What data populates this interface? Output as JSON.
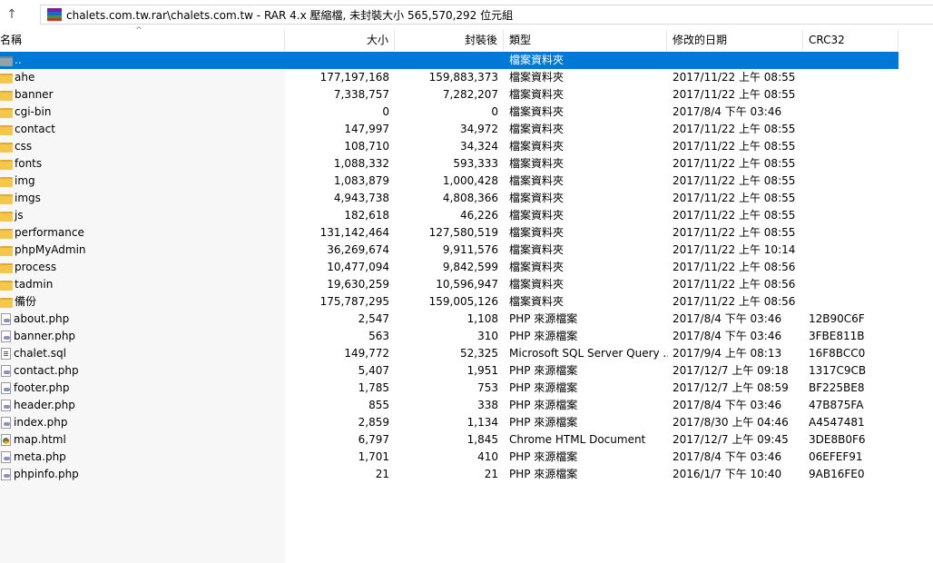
{
  "address_bar": {
    "text": "chalets.com.tw.rar\\chalets.com.tw - RAR 4.x 壓縮檔, 未封裝大小 565,570,292 位元組",
    "up_glyph": "↑"
  },
  "columns": {
    "name": "名稱",
    "size": "大小",
    "packed": "封裝後",
    "type": "類型",
    "modified": "修改的日期",
    "crc": "CRC32"
  },
  "sort_glyph": "^",
  "rows": [
    {
      "kind": "up",
      "name": "..",
      "size": "",
      "packed": "",
      "type": "檔案資料夾",
      "modified": "",
      "crc": ""
    },
    {
      "kind": "folder",
      "name": "ahe",
      "size": "177,197,168",
      "packed": "159,883,373",
      "type": "檔案資料夾",
      "modified": "2017/11/22 上午 08:55",
      "crc": ""
    },
    {
      "kind": "folder",
      "name": "banner",
      "size": "7,338,757",
      "packed": "7,282,207",
      "type": "檔案資料夾",
      "modified": "2017/11/22 上午 08:55",
      "crc": ""
    },
    {
      "kind": "folder",
      "name": "cgi-bin",
      "size": "0",
      "packed": "0",
      "type": "檔案資料夾",
      "modified": "2017/8/4 下午 03:46",
      "crc": ""
    },
    {
      "kind": "folder",
      "name": "contact",
      "size": "147,997",
      "packed": "34,972",
      "type": "檔案資料夾",
      "modified": "2017/11/22 上午 08:55",
      "crc": ""
    },
    {
      "kind": "folder",
      "name": "css",
      "size": "108,710",
      "packed": "34,324",
      "type": "檔案資料夾",
      "modified": "2017/11/22 上午 08:55",
      "crc": ""
    },
    {
      "kind": "folder",
      "name": "fonts",
      "size": "1,088,332",
      "packed": "593,333",
      "type": "檔案資料夾",
      "modified": "2017/11/22 上午 08:55",
      "crc": ""
    },
    {
      "kind": "folder",
      "name": "img",
      "size": "1,083,879",
      "packed": "1,000,428",
      "type": "檔案資料夾",
      "modified": "2017/11/22 上午 08:55",
      "crc": ""
    },
    {
      "kind": "folder",
      "name": "imgs",
      "size": "4,943,738",
      "packed": "4,808,366",
      "type": "檔案資料夾",
      "modified": "2017/11/22 上午 08:55",
      "crc": ""
    },
    {
      "kind": "folder",
      "name": "js",
      "size": "182,618",
      "packed": "46,226",
      "type": "檔案資料夾",
      "modified": "2017/11/22 上午 08:55",
      "crc": ""
    },
    {
      "kind": "folder",
      "name": "performance",
      "size": "131,142,464",
      "packed": "127,580,519",
      "type": "檔案資料夾",
      "modified": "2017/11/22 上午 08:55",
      "crc": ""
    },
    {
      "kind": "folder",
      "name": "phpMyAdmin",
      "size": "36,269,674",
      "packed": "9,911,576",
      "type": "檔案資料夾",
      "modified": "2017/11/22 上午 10:14",
      "crc": ""
    },
    {
      "kind": "folder",
      "name": "process",
      "size": "10,477,094",
      "packed": "9,842,599",
      "type": "檔案資料夾",
      "modified": "2017/11/22 上午 08:56",
      "crc": ""
    },
    {
      "kind": "folder",
      "name": "tadmin",
      "size": "19,630,259",
      "packed": "10,596,947",
      "type": "檔案資料夾",
      "modified": "2017/11/22 上午 08:56",
      "crc": ""
    },
    {
      "kind": "folder",
      "name": "備份",
      "size": "175,787,295",
      "packed": "159,005,126",
      "type": "檔案資料夾",
      "modified": "2017/11/22 上午 08:56",
      "crc": ""
    },
    {
      "kind": "php",
      "name": "about.php",
      "size": "2,547",
      "packed": "1,108",
      "type": "PHP 來源檔案",
      "modified": "2017/8/4 下午 03:46",
      "crc": "12B90C6F"
    },
    {
      "kind": "php",
      "name": "banner.php",
      "size": "563",
      "packed": "310",
      "type": "PHP 來源檔案",
      "modified": "2017/8/4 下午 03:46",
      "crc": "3FBE811B"
    },
    {
      "kind": "sql",
      "name": "chalet.sql",
      "size": "149,772",
      "packed": "52,325",
      "type": "Microsoft SQL Server Query ...",
      "modified": "2017/9/4 上午 08:13",
      "crc": "16F8BCC0"
    },
    {
      "kind": "php",
      "name": "contact.php",
      "size": "5,407",
      "packed": "1,951",
      "type": "PHP 來源檔案",
      "modified": "2017/12/7 上午 09:18",
      "crc": "1317C9CB"
    },
    {
      "kind": "php",
      "name": "footer.php",
      "size": "1,785",
      "packed": "753",
      "type": "PHP 來源檔案",
      "modified": "2017/12/7 上午 08:59",
      "crc": "BF225BE8"
    },
    {
      "kind": "php",
      "name": "header.php",
      "size": "855",
      "packed": "338",
      "type": "PHP 來源檔案",
      "modified": "2017/8/4 下午 03:46",
      "crc": "47B875FA"
    },
    {
      "kind": "php",
      "name": "index.php",
      "size": "2,859",
      "packed": "1,134",
      "type": "PHP 來源檔案",
      "modified": "2017/8/30 上午 04:46",
      "crc": "A4547481"
    },
    {
      "kind": "html",
      "name": "map.html",
      "size": "6,797",
      "packed": "1,845",
      "type": "Chrome HTML Document",
      "modified": "2017/12/7 上午 09:45",
      "crc": "3DE8B0F6"
    },
    {
      "kind": "php",
      "name": "meta.php",
      "size": "1,701",
      "packed": "410",
      "type": "PHP 來源檔案",
      "modified": "2017/8/4 下午 03:46",
      "crc": "06EFEF91"
    },
    {
      "kind": "php",
      "name": "phpinfo.php",
      "size": "21",
      "packed": "21",
      "type": "PHP 來源檔案",
      "modified": "2016/1/7 下午 10:40",
      "crc": "9AB16FE0"
    }
  ],
  "colors": {
    "selection": "#0078d7",
    "folder": "#f3c74a",
    "name_column_bg": "#f7f7f7"
  }
}
